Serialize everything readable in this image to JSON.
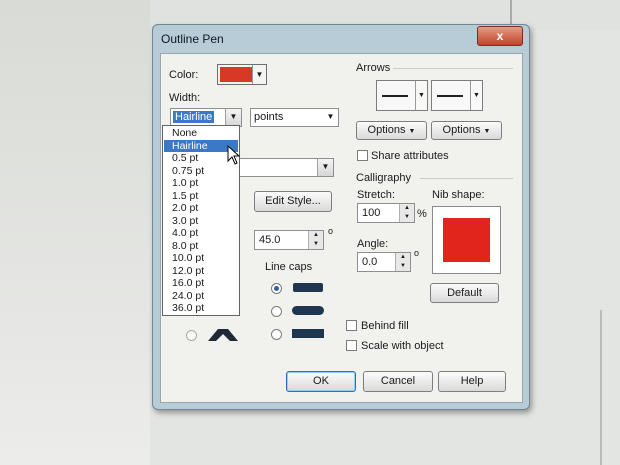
{
  "dialog": {
    "title": "Outline Pen",
    "close_glyph": "x",
    "color_label": "Color:",
    "color_swatch": "#d63a26",
    "width_label": "Width:",
    "width_value": "Hairline",
    "units_value": "points",
    "width_options": [
      "None",
      "Hairline",
      "0.5 pt",
      "0.75 pt",
      "1.0 pt",
      "1.5 pt",
      "2.0 pt",
      "3.0 pt",
      "4.0 pt",
      "8.0 pt",
      "10.0 pt",
      "12.0 pt",
      "16.0 pt",
      "24.0 pt",
      "36.0 pt"
    ],
    "selected_option_index": 1,
    "edit_style_label": "Edit Style...",
    "miter_value": "45.0",
    "degree_symbol": "o",
    "line_caps_label": "Line caps",
    "arrows_label": "Arrows",
    "options_label": "Options",
    "share_attributes_label": "Share attributes",
    "calligraphy_label": "Calligraphy",
    "stretch_label": "Stretch:",
    "stretch_value": "100",
    "percent_symbol": "%",
    "nib_shape_label": "Nib shape:",
    "nib_color": "#e0261c",
    "angle_label": "Angle:",
    "angle_value": "0.0",
    "default_label": "Default",
    "behind_fill_label": "Behind fill",
    "scale_with_object_label": "Scale with object",
    "ok_label": "OK",
    "cancel_label": "Cancel",
    "help_label": "Help"
  }
}
